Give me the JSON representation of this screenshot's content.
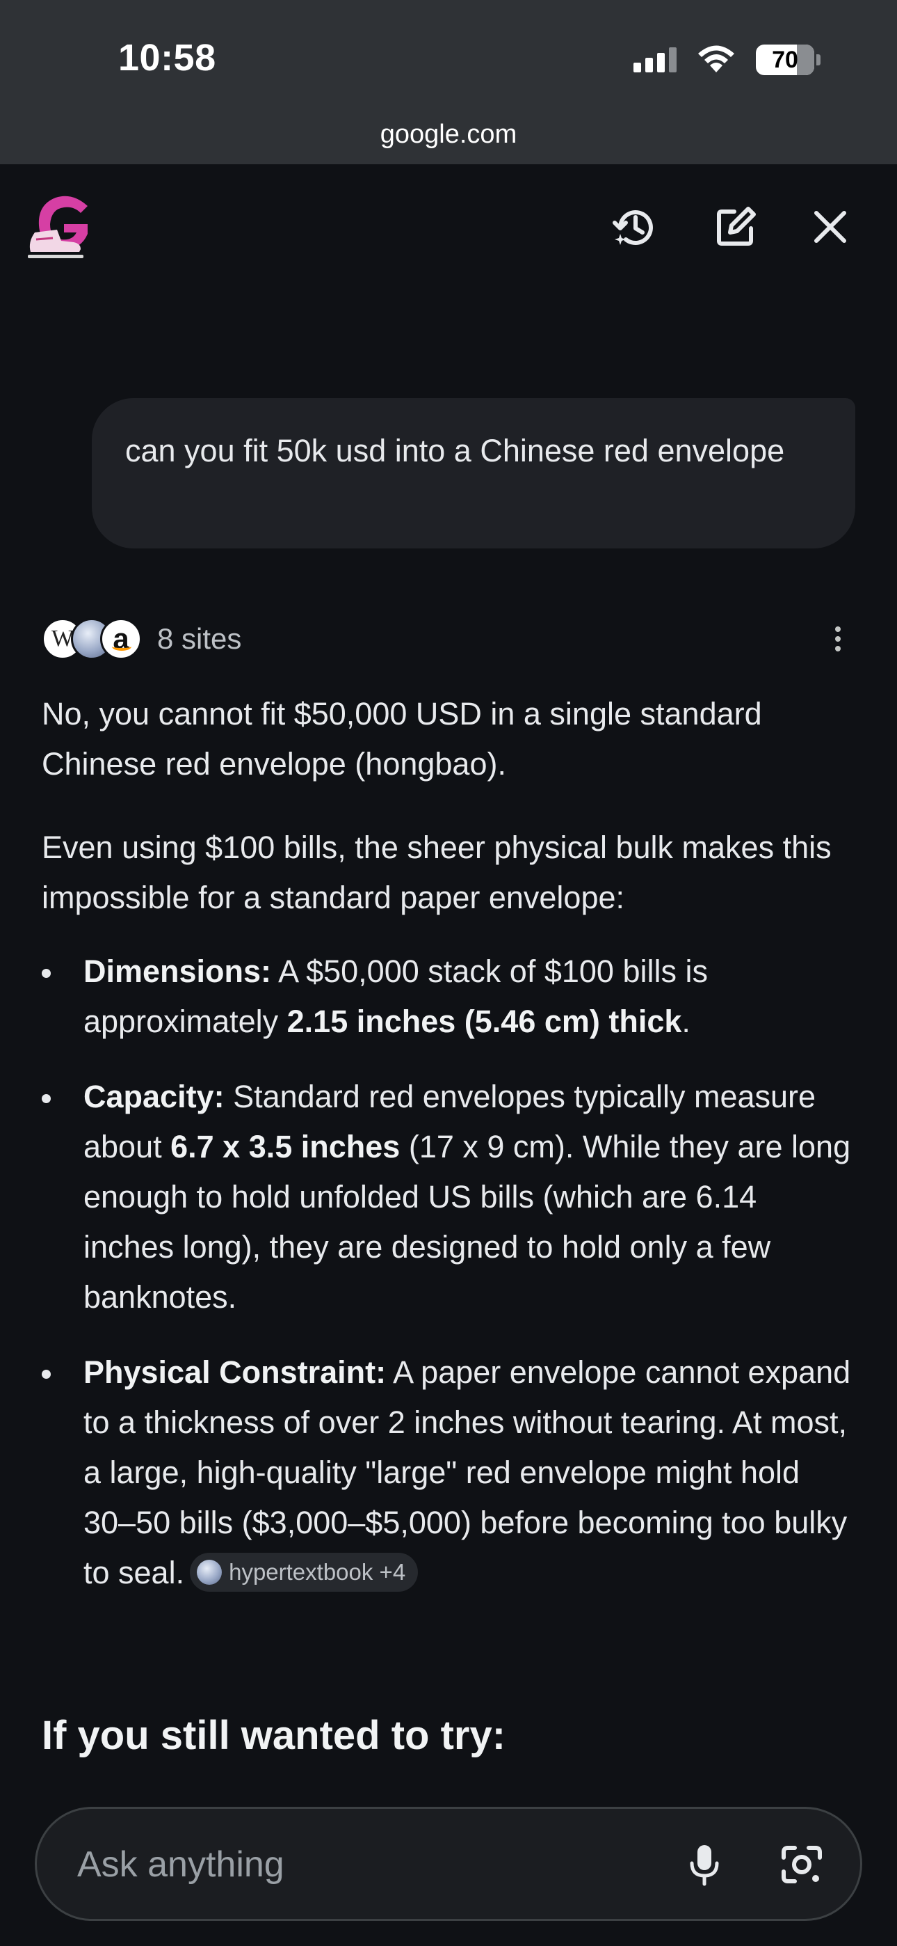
{
  "status_bar": {
    "time": "10:58",
    "battery_level": "70"
  },
  "browser": {
    "url": "google.com"
  },
  "header": {
    "icons": [
      "history-icon",
      "edit-icon",
      "close-icon"
    ]
  },
  "query": {
    "text": "can you fit 50k usd into a Chinese red envelope"
  },
  "sources": {
    "count_label": "8 sites",
    "favicons": [
      "wikipedia",
      "globe",
      "amazon"
    ]
  },
  "answer": {
    "intro": "No, you cannot fit $50,000 USD in a single standard Chinese red envelope (hongbao).",
    "lead": "Even using $100 bills, the sheer physical bulk makes this impossible for a standard paper envelope:",
    "bullets": [
      {
        "label": "Dimensions:",
        "text_1": " A $50,000 stack of $100 bills is approximately ",
        "bold_1": "2.15 inches (5.46 cm) thick",
        "text_2": "."
      },
      {
        "label": "Capacity:",
        "text_1": " Standard red envelopes typically measure about ",
        "bold_1": "6.7 x 3.5 inches",
        "text_2": " (17 x 9 cm). While they are long enough to hold unfolded US bills (which are 6.14 inches long), they are designed to hold only a few banknotes."
      },
      {
        "label": "Physical Constraint:",
        "text_1": " A paper envelope cannot expand to a thickness of over 2 inches without tearing. At most, a large, high-quality \"large\" red envelope might hold 30–50 bills ($3,000–$5,000) before becoming too bulky to seal.",
        "citation": "hypertextbook +4"
      }
    ],
    "section_heading": "If you still wanted to try:"
  },
  "input": {
    "placeholder": "Ask anything"
  },
  "colors": {
    "background": "#0f1115",
    "chrome": "#2f3236",
    "bubble": "#1f2126"
  }
}
